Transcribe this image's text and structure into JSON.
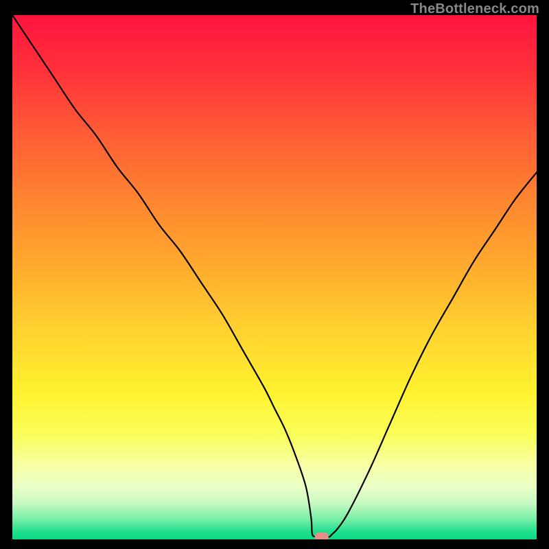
{
  "watermark": "TheBottleneck.com",
  "colors": {
    "background": "#000000",
    "curve": "#000000",
    "marker_fill": "#E88E88",
    "gradient": [
      {
        "offset": 0.0,
        "hex": "#FF143D"
      },
      {
        "offset": 0.1,
        "hex": "#FF2F3A"
      },
      {
        "offset": 0.22,
        "hex": "#FF5A36"
      },
      {
        "offset": 0.35,
        "hex": "#FF8430"
      },
      {
        "offset": 0.48,
        "hex": "#FFAB2E"
      },
      {
        "offset": 0.6,
        "hex": "#FFD22F"
      },
      {
        "offset": 0.72,
        "hex": "#FFF22F"
      },
      {
        "offset": 0.8,
        "hex": "#FAFF59"
      },
      {
        "offset": 0.86,
        "hex": "#F6FFA6"
      },
      {
        "offset": 0.9,
        "hex": "#EAFFC8"
      },
      {
        "offset": 0.93,
        "hex": "#C9FAC2"
      },
      {
        "offset": 0.96,
        "hex": "#7BEFA8"
      },
      {
        "offset": 0.985,
        "hex": "#22E08F"
      },
      {
        "offset": 1.0,
        "hex": "#0AD884"
      }
    ]
  },
  "chart_data": {
    "type": "line",
    "title": "",
    "xlabel": "",
    "ylabel": "",
    "xlim": [
      0,
      100
    ],
    "ylim": [
      0,
      100
    ],
    "grid": false,
    "series_note": "y is bottleneck percentage (0 = green/optimal at bottom, 100 = red at top). x is a relative position along the horizontal axis (0 left to 100 right). Values estimated from pixel positions.",
    "x": [
      0,
      4,
      8,
      12,
      16,
      20,
      24,
      28,
      32,
      36,
      40,
      44,
      48,
      50,
      52,
      54,
      56,
      57,
      57.2,
      58,
      60,
      60.5,
      61,
      62,
      64,
      68,
      72,
      76,
      80,
      84,
      88,
      92,
      96,
      100
    ],
    "values": [
      100,
      94,
      88,
      82,
      77,
      71,
      66,
      60,
      55,
      49,
      43,
      36,
      29,
      25,
      21,
      16,
      10,
      4,
      1,
      0.5,
      0.5,
      0.5,
      1,
      2,
      5,
      13,
      22,
      31,
      39,
      46,
      53,
      59,
      65,
      70
    ],
    "marker": {
      "x": 59,
      "y": 0.5,
      "shape": "rounded-rect",
      "fill": "#E88E88"
    }
  }
}
